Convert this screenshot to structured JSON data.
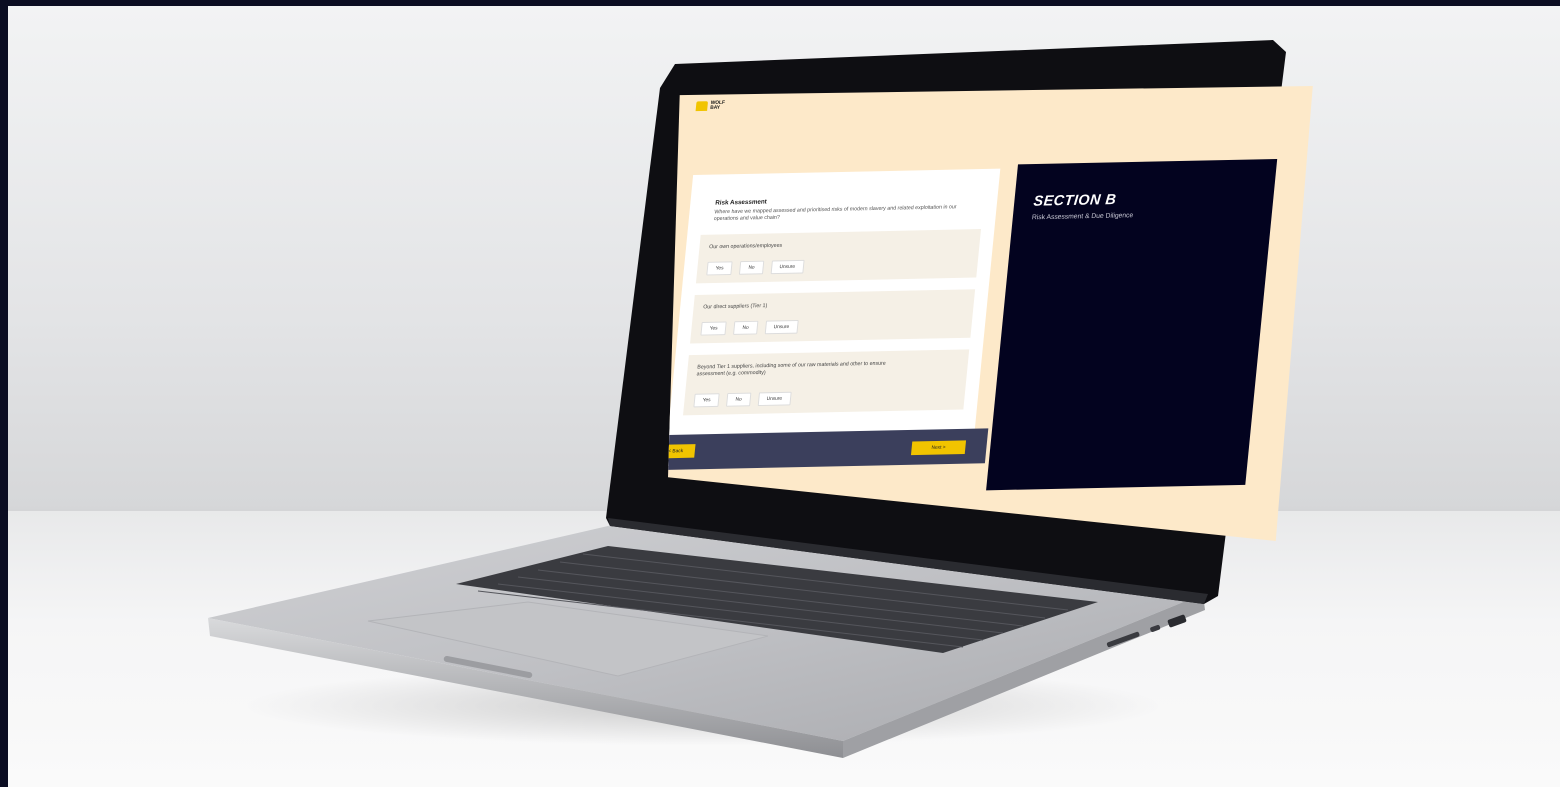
{
  "app": {
    "logo_text": "WOLF BAY"
  },
  "form": {
    "title": "Risk Assessment",
    "description": "Where have we mapped assessed and prioritised risks of modern slavery and related exploitation in our operations and value chain?",
    "questions": [
      {
        "label": "Our own operations/employees",
        "options": [
          "Yes",
          "No",
          "Unsure"
        ]
      },
      {
        "label": "Our direct suppliers (Tier 1)",
        "options": [
          "Yes",
          "No",
          "Unsure"
        ]
      },
      {
        "label": "Beyond Tier 1 suppliers, including some of our raw materials and other to ensure",
        "label_line2": "assessment (e.g. commodity)",
        "options": [
          "Yes",
          "No",
          "Unsure"
        ]
      }
    ],
    "back_label": "< Back",
    "next_label": "Next >"
  },
  "sidebar": {
    "title": "SECTION B",
    "subtitle": "Risk Assessment & Due Diligence"
  },
  "colors": {
    "accent": "#f1c400",
    "navy": "#03031f",
    "cream": "#fde9c9",
    "footer": "#3b3f5c"
  }
}
